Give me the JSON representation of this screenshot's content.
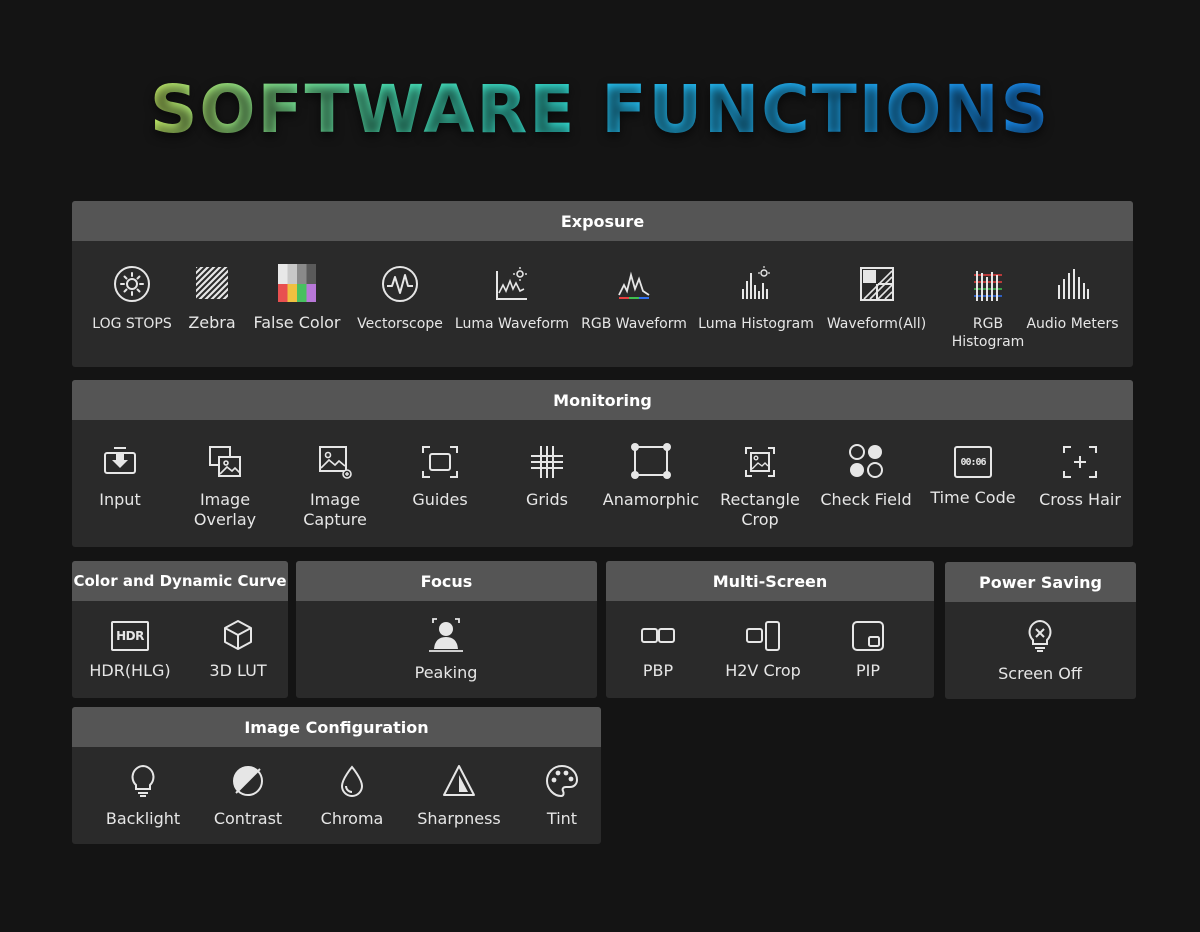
{
  "title": {
    "word1": "SOFTWARE",
    "word2": "FUNCTIONS"
  },
  "exposure": {
    "header": "Exposure",
    "items": [
      {
        "label": "LOG STOPS",
        "icon": "log-stops-icon"
      },
      {
        "label": "Zebra",
        "icon": "zebra-icon"
      },
      {
        "label": "False Color",
        "icon": "false-color-icon"
      },
      {
        "label": "Vectorscope",
        "icon": "vectorscope-icon"
      },
      {
        "label": "Luma Waveform",
        "icon": "luma-waveform-icon"
      },
      {
        "label": "RGB Waveform",
        "icon": "rgb-waveform-icon"
      },
      {
        "label": "Luma Histogram",
        "icon": "luma-histogram-icon"
      },
      {
        "label": "Waveform(All)",
        "icon": "waveform-all-icon"
      },
      {
        "label1": "RGB",
        "label2": "Histogram",
        "icon": "rgb-histogram-icon"
      },
      {
        "label": "Audio Meters",
        "icon": "audio-meters-icon"
      }
    ]
  },
  "monitoring": {
    "header": "Monitoring",
    "items": [
      {
        "label": "Input",
        "icon": "input-icon"
      },
      {
        "label1": "Image",
        "label2": "Overlay",
        "icon": "image-overlay-icon"
      },
      {
        "label1": "Image",
        "label2": "Capture",
        "icon": "image-capture-icon"
      },
      {
        "label": "Guides",
        "icon": "guides-icon"
      },
      {
        "label": "Grids",
        "icon": "grids-icon"
      },
      {
        "label": "Anamorphic",
        "icon": "anamorphic-icon"
      },
      {
        "label1": "Rectangle",
        "label2": "Crop",
        "icon": "rectangle-crop-icon"
      },
      {
        "label": "Check Field",
        "icon": "check-field-icon"
      },
      {
        "label": "Time Code",
        "icon": "time-code-icon"
      },
      {
        "label": "Cross Hair",
        "icon": "cross-hair-icon"
      }
    ],
    "timecode_glyph": "00:06"
  },
  "color": {
    "header": "Color and Dynamic Curve",
    "items": [
      {
        "label": "HDR(HLG)",
        "icon": "hdr-icon",
        "glyph": "HDR"
      },
      {
        "label": "3D LUT",
        "icon": "cube-icon"
      }
    ]
  },
  "focus": {
    "header": "Focus",
    "items": [
      {
        "label": "Peaking",
        "icon": "peaking-icon"
      }
    ]
  },
  "multiscreen": {
    "header": "Multi-Screen",
    "items": [
      {
        "label": "PBP",
        "icon": "pbp-icon"
      },
      {
        "label": "H2V Crop",
        "icon": "h2v-crop-icon"
      },
      {
        "label": "PIP",
        "icon": "pip-icon"
      }
    ]
  },
  "power": {
    "header": "Power Saving",
    "items": [
      {
        "label": "Screen Off",
        "icon": "bulb-off-icon"
      }
    ]
  },
  "imageconfig": {
    "header": "Image Configuration",
    "items": [
      {
        "label": "Backlight",
        "icon": "bulb-icon"
      },
      {
        "label": "Contrast",
        "icon": "contrast-icon"
      },
      {
        "label": "Chroma",
        "icon": "drop-icon"
      },
      {
        "label": "Sharpness",
        "icon": "sharpness-icon"
      },
      {
        "label": "Tint",
        "icon": "palette-icon"
      }
    ]
  },
  "colors": {
    "background": "#141414",
    "panel": "#2a2a2a",
    "header": "#555555",
    "title_green": "#9ef07a",
    "title_blue": "#1ea8f4"
  }
}
